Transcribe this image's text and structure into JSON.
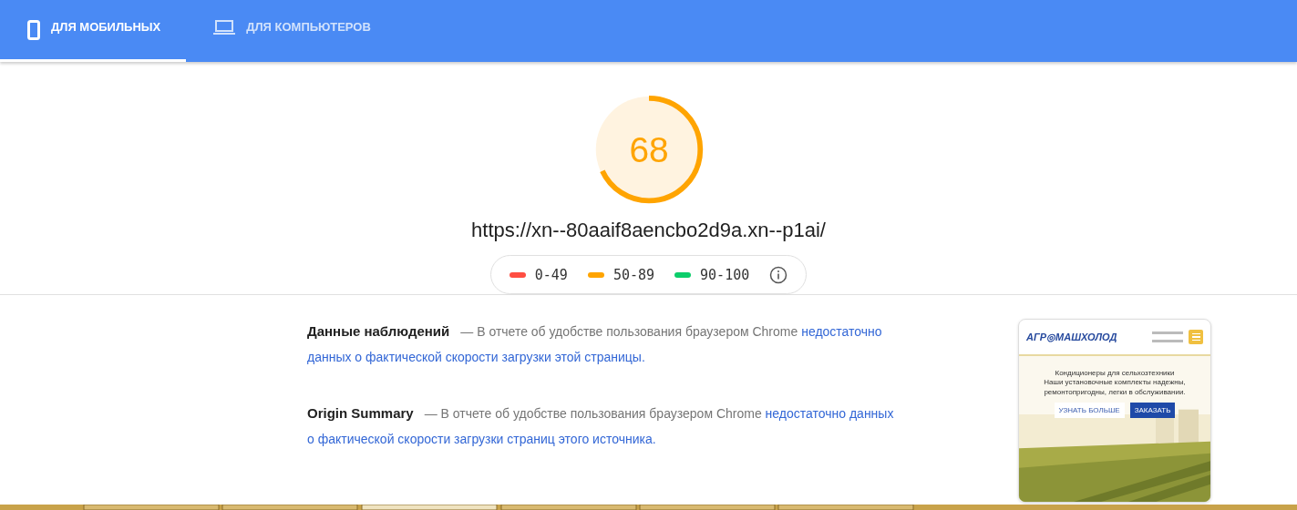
{
  "tabs": [
    {
      "label": "ДЛЯ МОБИЛЬНЫХ",
      "kind": "mobile",
      "selected": true
    },
    {
      "label": "ДЛЯ КОМПЬЮТЕРОВ",
      "kind": "desktop",
      "selected": false
    }
  ],
  "score": {
    "value": "68"
  },
  "url": "https://xn--80aaif8aencbo2d9a.xn--p1ai/",
  "legend": [
    {
      "range": "0-49",
      "color": "#ff4e42"
    },
    {
      "range": "50-89",
      "color": "#ffa400"
    },
    {
      "range": "90-100",
      "color": "#0cce6b"
    }
  ],
  "sections": [
    {
      "title": "Данные наблюдений",
      "text": "— В отчете об удобстве пользования браузером Chrome",
      "link": [
        "недостаточно",
        "данных о фактической скорости загрузки этой страницы."
      ]
    },
    {
      "title": "Origin Summary",
      "text": "— В отчете об удобстве пользования браузером Chrome",
      "link": [
        "недостаточно данных",
        "о фактической скорости загрузки страниц этого источника."
      ]
    }
  ],
  "preview": {
    "logo": "АГР◎МАШХОЛОД",
    "heading": "Кондиционеры для сельхозтехники",
    "subheading": "Наши установочные комплекты надежны, ремонтопригодны, легки в обслуживании.",
    "buttons": [
      "УЗНАТЬ БОЛЬШЕ",
      "ЗАКАЗАТЬ"
    ]
  }
}
